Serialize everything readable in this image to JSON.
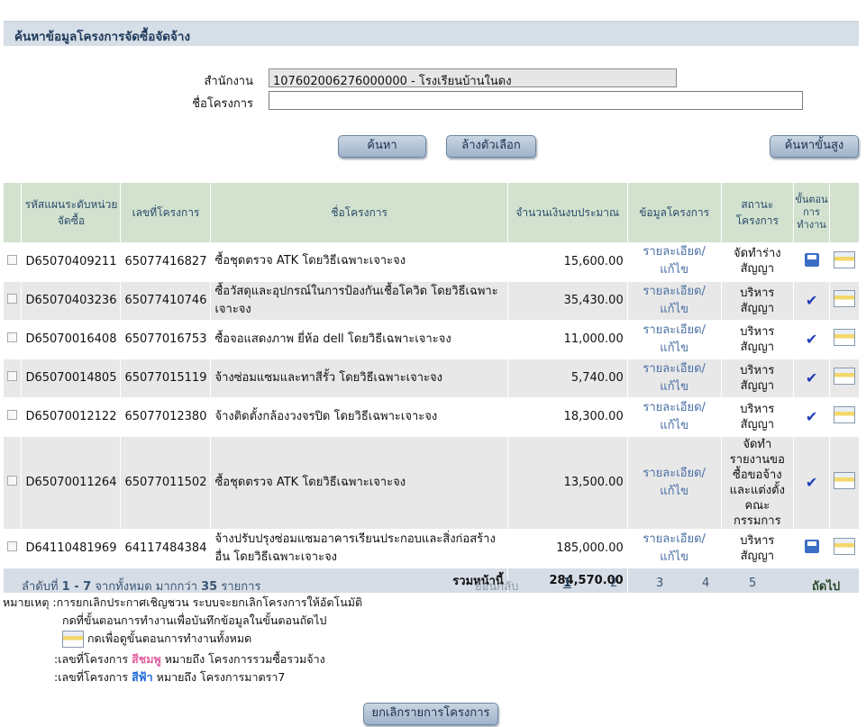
{
  "header": {
    "title": "ค้นหาข้อมูลโครงการจัดซื้อจัดจ้าง"
  },
  "form": {
    "agency_label": "สำนักงาน",
    "agency_value": "107602006276000000 - โรงเรียนบ้านในดง",
    "project_label": "ชื่อโครงการ",
    "project_value": ""
  },
  "buttons": {
    "search": "ค้นหา",
    "clear": "ล้างตัวเลือก",
    "advanced": "ค้นหาขั้นสูง",
    "cancel_list": "ยกเลิกรายการโครงการ"
  },
  "table": {
    "headers": {
      "plan_code": "รหัสแผนระดับหน่วยจัดซื้อ",
      "project_no": "เลขที่โครงการ",
      "project_name": "ชื่อโครงการ",
      "budget": "จำนวนเงินงบประมาณ",
      "info": "ข้อมูลโครงการ",
      "status": "สถานะโครงการ",
      "step": "ขั้นตอนการทำงาน"
    },
    "rows": [
      {
        "plan": "D65070409211",
        "no": "65077416827",
        "name": "ซื้อชุดตรวจ ATK โดยวิธีเฉพาะเจาะจง",
        "amount": "15,600.00",
        "link": "รายละเอียด/แก้ไข",
        "status": "จัดทำร่างสัญญา",
        "step_icon": "save-icon"
      },
      {
        "plan": "D65070403236",
        "no": "65077410746",
        "name": "ซื้อวัสดุและอุปกรณ์ในการป้องกันเชื้อโควิด โดยวิธีเฉพาะเจาะจง",
        "amount": "35,430.00",
        "link": "รายละเอียด/แก้ไข",
        "status": "บริหารสัญญา",
        "step_icon": "check-icon"
      },
      {
        "plan": "D65070016408",
        "no": "65077016753",
        "name": "ซื้อจอแสดงภาพ ยี่ห้อ dell โดยวิธีเฉพาะเจาะจง",
        "amount": "11,000.00",
        "link": "รายละเอียด/แก้ไข",
        "status": "บริหารสัญญา",
        "step_icon": "check-icon"
      },
      {
        "plan": "D65070014805",
        "no": "65077015119",
        "name": "จ้างซ่อมแซมและทาสีรั้ว โดยวิธีเฉพาะเจาะจง",
        "amount": "5,740.00",
        "link": "รายละเอียด/แก้ไข",
        "status": "บริหารสัญญา",
        "step_icon": "check-icon"
      },
      {
        "plan": "D65070012122",
        "no": "65077012380",
        "name": "จ้างติดตั้งกล้องวงจรปิด โดยวิธีเฉพาะเจาะจง",
        "amount": "18,300.00",
        "link": "รายละเอียด/แก้ไข",
        "status": "บริหารสัญญา",
        "step_icon": "check-icon"
      },
      {
        "plan": "D65070011264",
        "no": "65077011502",
        "name": "ซื้อชุดตรวจ ATK โดยวิธีเฉพาะเจาะจง",
        "amount": "13,500.00",
        "link": "รายละเอียด/แก้ไข",
        "status": "จัดทำรายงานขอซื้อขอจ้างและแต่งตั้งคณะกรรมการ",
        "step_icon": "check-icon"
      },
      {
        "plan": "D64110481969",
        "no": "64117484384",
        "name": "จ้างปรับปรุงซ่อมแซมอาคารเรียนประกอบและสิ่งก่อสร้างอื่น โดยวิธีเฉพาะเจาะจง",
        "amount": "185,000.00",
        "link": "รายละเอียด/แก้ไข",
        "status": "บริหารสัญญา",
        "step_icon": "save-icon"
      }
    ],
    "total_label": "รวมหน้านี้",
    "total_amount": "284,570.00"
  },
  "pager": {
    "summary_prefix": "ลำดับที่",
    "summary_range": "1 - 7",
    "summary_mid": "จากทั้งหมด มากกว่า",
    "summary_count": "35",
    "summary_suffix": "รายการ",
    "back": "ย้อนกลับ",
    "pages": [
      "1",
      "2",
      "3",
      "4",
      "5"
    ],
    "current_page": "1",
    "next": "ถัดไป"
  },
  "notes": {
    "label": "หมายเหตุ :",
    "line1": "การยกเลิกประกาศเชิญชวน ระบบจะยกเลิกโครงการให้อัตโนมัติ",
    "line2": "กดที่ขั้นตอนการทำงานเพื่อบันทึกข้อมูลในขั้นตอนถัดไป",
    "line3": "กดเพื่อดูขั้นตอนการทำงานทั้งหมด",
    "line4_prefix": ":เลขที่โครงการ",
    "line4_color": "สีชมพู",
    "line4_suffix": "หมายถึง โครงการรวมซื้อรวมจ้าง",
    "line5_prefix": ":เลขที่โครงการ",
    "line5_color": "สีฟ้า",
    "line5_suffix": "หมายถึง โครงการมาตรา7"
  },
  "colors": {
    "header_bg": "#d6dee7",
    "table_header_bg": "#d2e2cf",
    "pink": "#e060a0",
    "blue": "#1e6ad8"
  }
}
